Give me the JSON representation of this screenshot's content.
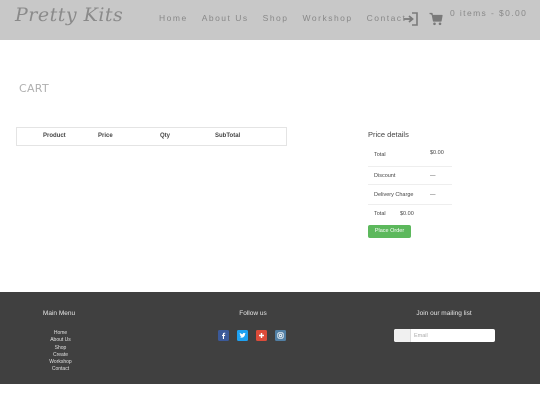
{
  "header": {
    "logo": "Pretty Kits",
    "nav": [
      "Home",
      "About Us",
      "Shop",
      "Workshop",
      "Contact"
    ],
    "cart_summary": "0 items - $0.00"
  },
  "main": {
    "title": "CART",
    "table_headers": [
      "Product",
      "Price",
      "Qty",
      "SubTotal"
    ]
  },
  "price_details": {
    "title": "Price details",
    "rows": [
      {
        "label": "Total",
        "value": "$0.00"
      },
      {
        "label": "Discount",
        "value": "—"
      },
      {
        "label": "Delivery Charge",
        "value": "—"
      },
      {
        "label": "Total",
        "value": "$0.00"
      }
    ],
    "place_order": "Place Order"
  },
  "footer": {
    "main_menu_title": "Main Menu",
    "main_menu": [
      "Home",
      "About Us",
      "Shop",
      "Create",
      "Workshop",
      "Contact"
    ],
    "follow_title": "Follow us",
    "social": [
      {
        "icon": "facebook-icon",
        "color": "#3b5998"
      },
      {
        "icon": "twitter-icon",
        "color": "#1da1f2"
      },
      {
        "icon": "google-plus-icon",
        "color": "#dd4b39"
      },
      {
        "icon": "instagram-icon",
        "color": "#517fa4"
      }
    ],
    "mailing_title": "Join our mailing list",
    "email_placeholder": "Email"
  }
}
